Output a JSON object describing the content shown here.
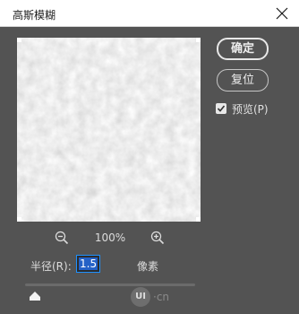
{
  "window": {
    "title": "高斯模糊"
  },
  "buttons": {
    "ok": "确定",
    "reset": "复位"
  },
  "preview_option": {
    "label": "预览(P)",
    "checked": true
  },
  "zoom": {
    "level": "100%"
  },
  "radius": {
    "label": "半径(R):",
    "value": "1.5",
    "unit": "像素"
  },
  "watermark": {
    "logo": "UI",
    "text": "·cn"
  },
  "icons": {
    "close": "close-icon",
    "zoom_out": "zoom-out-icon",
    "zoom_in": "zoom-in-icon",
    "check": "checkmark-icon",
    "slider": "slider-thumb-icon"
  },
  "colors": {
    "dialog_bg": "#535353",
    "titlebar_bg": "#ffffff",
    "input_border": "#1e90ff",
    "selection": "#2461c6"
  }
}
